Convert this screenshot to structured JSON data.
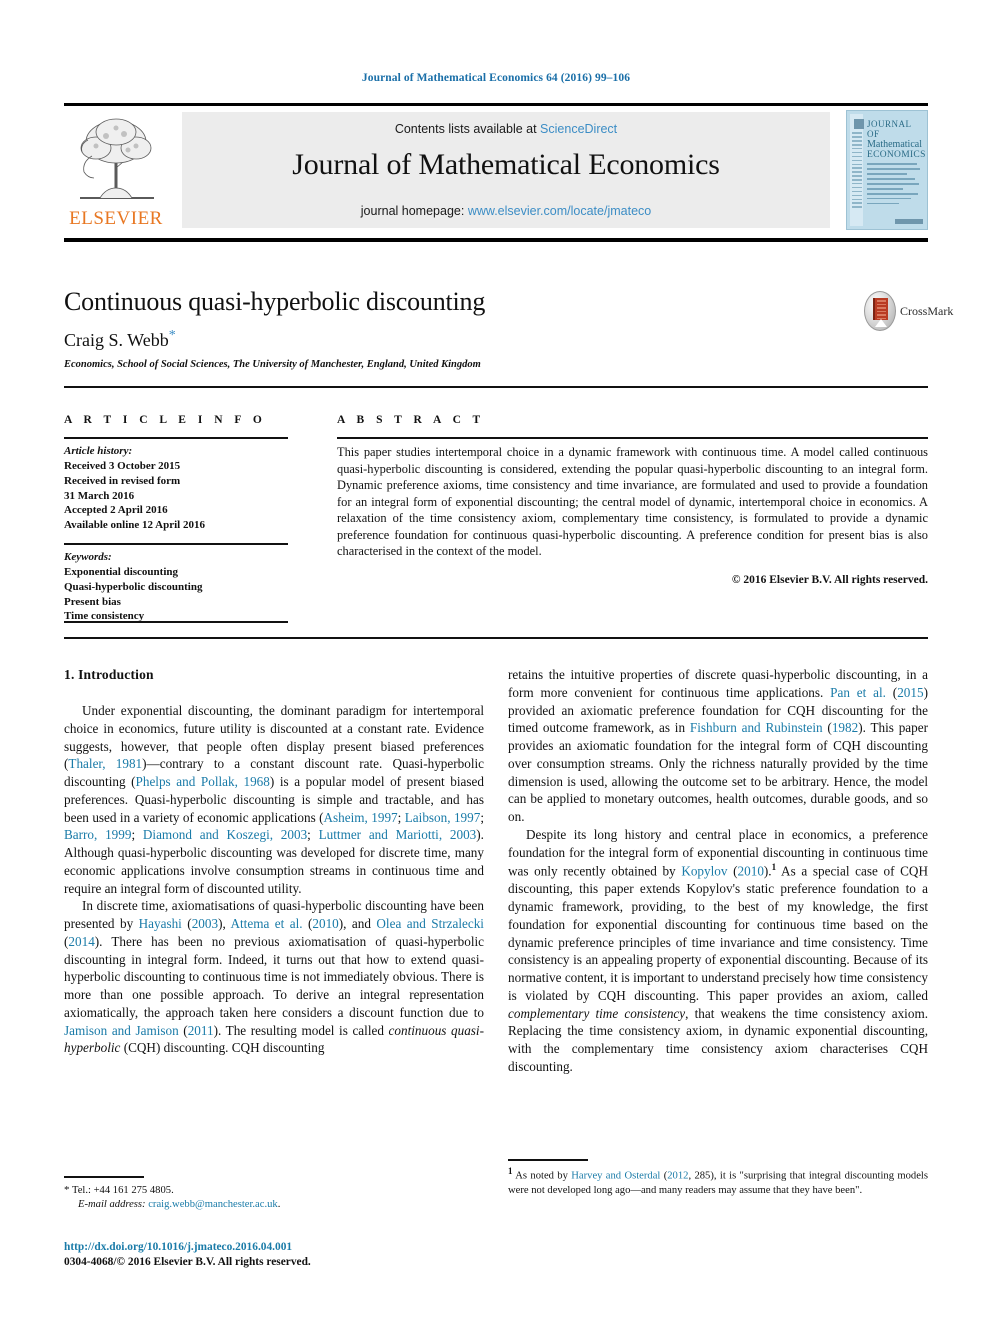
{
  "running_head": "Journal of Mathematical Economics 64 (2016) 99–106",
  "masthead": {
    "contents_prefix": "Contents lists available at ",
    "sciencedirect": "ScienceDirect",
    "journal_title": "Journal of Mathematical Economics",
    "homepage_prefix": "journal homepage: ",
    "homepage_url": "www.elsevier.com/locate/jmateco",
    "publisher_logo_text": "ELSEVIER",
    "accent_link_color": "#3c8dc5",
    "cover": {
      "line1": "JOURNAL OF",
      "line2": "Mathematical",
      "line3": "ECONOMICS"
    }
  },
  "article": {
    "title": "Continuous quasi-hyperbolic discounting",
    "author": "Craig S. Webb",
    "author_footnote_marker": "*",
    "affiliation": "Economics, School of Social Sciences, The University of Manchester, England, United Kingdom",
    "crossmark_label": "CrossMark"
  },
  "info": {
    "heading": "A R T I C L E   I N F O",
    "history_label": "Article history:",
    "history_lines": [
      "Received 3 October 2015",
      "Received in revised form",
      "31 March 2016",
      "Accepted 2 April 2016",
      "Available online 12 April 2016"
    ],
    "keywords_label": "Keywords:",
    "keywords": [
      "Exponential discounting",
      "Quasi-hyperbolic discounting",
      "Present bias",
      "Time consistency"
    ]
  },
  "abstract": {
    "heading": "A B S T R A C T",
    "text": "This paper studies intertemporal choice in a dynamic framework with continuous time. A model called continuous quasi-hyperbolic discounting is considered, extending the popular quasi-hyperbolic discounting to an integral form. Dynamic preference axioms, time consistency and time invariance, are formulated and used to provide a foundation for an integral form of exponential discounting; the central model of dynamic, intertemporal choice in economics. A relaxation of the time consistency axiom, complementary time consistency, is formulated to provide a dynamic preference foundation for continuous quasi-hyperbolic discounting. A preference condition for present bias is also characterised in the context of the model.",
    "copyright": "© 2016 Elsevier B.V. All rights reserved."
  },
  "body": {
    "section_heading": "1. Introduction",
    "left_p1_a": "Under exponential discounting, the dominant paradigm for intertemporal choice in economics, future utility is discounted at a constant rate. Evidence suggests, however, that people often display present biased preferences (",
    "left_p1_cite1": "Thaler, 1981",
    "left_p1_b": ")—contrary to a constant discount rate. Quasi-hyperbolic discounting (",
    "left_p1_cite2": "Phelps and Pollak, 1968",
    "left_p1_c": ") is a popular model of present biased preferences. Quasi-hyperbolic discounting is simple and tractable, and has been used in a variety of economic applications (",
    "left_p1_cite3": "Asheim, 1997",
    "left_p1_d": "; ",
    "left_p1_cite4": "Laibson, 1997",
    "left_p1_e": "; ",
    "left_p1_cite5": "Barro, 1999",
    "left_p1_f": "; ",
    "left_p1_cite6": "Diamond and Koszegi, 2003",
    "left_p1_g": "; ",
    "left_p1_cite7": "Luttmer and Mariotti, 2003",
    "left_p1_h": "). Although quasi-hyperbolic discounting was developed for discrete time, many economic applications involve consumption streams in continuous time and require an integral form of discounted utility.",
    "left_p2_a": "In discrete time, axiomatisations of quasi-hyperbolic discounting have been presented by ",
    "left_p2_cite1": "Hayashi",
    "left_p2_b": " (",
    "left_p2_cite2": "2003",
    "left_p2_c": "), ",
    "left_p2_cite3": "Attema et al.",
    "left_p2_d": " (",
    "left_p2_cite4": "2010",
    "left_p2_e": "), and ",
    "left_p2_cite5": "Olea and Strzalecki",
    "left_p2_f": " (",
    "left_p2_cite6": "2014",
    "left_p2_g": "). There has been no previous axiomatisation of quasi-hyperbolic discounting in integral form. Indeed, it turns out that how to extend quasi-hyperbolic discounting to continuous time is not immediately obvious. There is more than one possible approach. To derive an integral representation axiomatically, the approach taken here considers a discount function due to ",
    "left_p2_cite7": "Jamison and Jamison",
    "left_p2_h": " (",
    "left_p2_cite8": "2011",
    "left_p2_i": "). The resulting model is called ",
    "left_p2_italic": "continuous quasi-hyperbolic",
    "left_p2_j": " (CQH) discounting. CQH discounting",
    "right_p1_a": "retains the intuitive properties of discrete quasi-hyperbolic discounting, in a form more convenient for continuous time applications. ",
    "right_p1_cite1": "Pan et al.",
    "right_p1_b": " (",
    "right_p1_cite2": "2015",
    "right_p1_c": ") provided an axiomatic preference foundation for CQH discounting for the timed outcome framework, as in ",
    "right_p1_cite3": "Fishburn and Rubinstein",
    "right_p1_d": " (",
    "right_p1_cite4": "1982",
    "right_p1_e": "). This paper provides an axiomatic foundation for the integral form of CQH discounting over consumption streams. Only the richness naturally provided by the time dimension is used, allowing the outcome set to be arbitrary. Hence, the model can be applied to monetary outcomes, health outcomes, durable goods, and so on.",
    "right_p2_a": "Despite its long history and central place in economics, a preference foundation for the integral form of exponential discounting in continuous time was only recently obtained by ",
    "right_p2_cite1": "Kopylov",
    "right_p2_b": " (",
    "right_p2_cite2": "2010",
    "right_p2_c": ").",
    "right_p2_fn": "1",
    "right_p2_d": " As a special case of CQH discounting, this paper extends Kopylov's static preference foundation to a dynamic framework, providing, to the best of my knowledge, the first foundation for exponential discounting for continuous time based on the dynamic preference principles of time invariance and time consistency. Time consistency is an appealing property of exponential discounting. Because of its normative content, it is important to understand precisely how time consistency is violated by CQH discounting. This paper provides an axiom, called ",
    "right_p2_italic": "complementary time consistency",
    "right_p2_e": ", that weakens the time consistency axiom. Replacing the time consistency axiom, in dynamic exponential discounting, with the complementary time consistency axiom characterises CQH discounting."
  },
  "footnotes": {
    "left_marker": "*",
    "left_tel": "Tel.: +44 161 275 4805.",
    "left_email_label": "E-mail address:",
    "left_email": "craig.webb@manchester.ac.uk",
    "right_marker": "1",
    "right_a": " As noted by ",
    "right_cite1": "Harvey and Osterdal",
    "right_b": " (",
    "right_cite2": "2012",
    "right_c": ", 285), it is \"surprising that integral discounting models were not developed long ago—and many readers may assume that they have been\"."
  },
  "imprint": {
    "doi": "http://dx.doi.org/10.1016/j.jmateco.2016.04.001",
    "issn_line": "0304-4068/© 2016 Elsevier B.V. All rights reserved."
  }
}
